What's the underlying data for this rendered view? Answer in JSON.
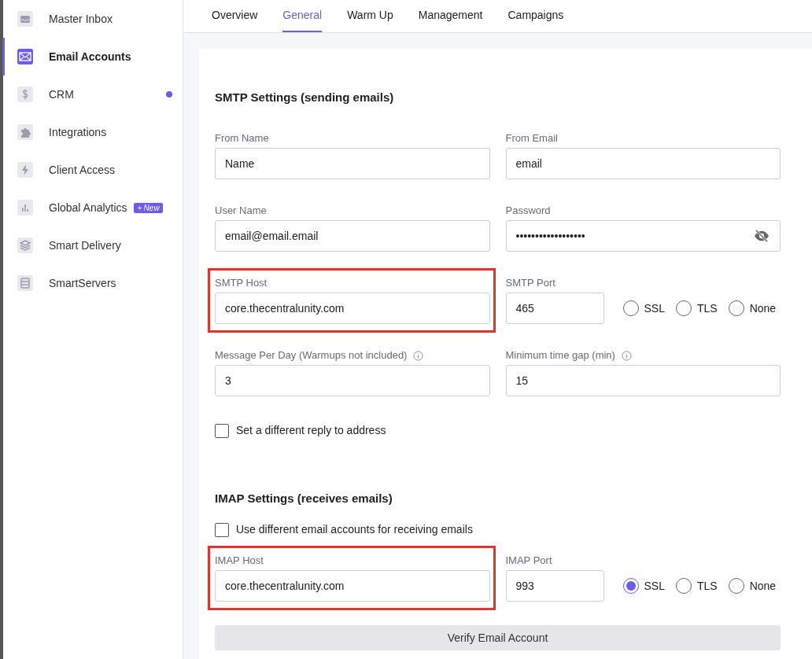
{
  "sidebar": {
    "items": [
      {
        "label": "Master Inbox",
        "selected": false
      },
      {
        "label": "Email Accounts",
        "selected": true
      },
      {
        "label": "CRM",
        "selected": false,
        "color": "#6a5cf0"
      },
      {
        "label": "Integrations",
        "selected": false
      },
      {
        "label": "Client Access",
        "selected": false
      },
      {
        "label": "Global Analytics",
        "selected": false,
        "badge": "New"
      },
      {
        "label": "Smart Delivery",
        "selected": false
      },
      {
        "label": "SmartServers",
        "selected": false
      }
    ]
  },
  "tabs": [
    {
      "label": "Overview",
      "selected": false
    },
    {
      "label": "General",
      "selected": true
    },
    {
      "label": "Warm Up",
      "selected": false
    },
    {
      "label": "Management",
      "selected": false
    },
    {
      "label": "Campaigns",
      "selected": false
    }
  ],
  "smtp": {
    "title": "SMTP Settings (sending emails)",
    "rows": [
      [
        {
          "kind": "text",
          "label": "From Name",
          "value": "Name",
          "highlighted": false
        },
        {
          "kind": "text",
          "label": "From Email",
          "value": "email",
          "highlighted": false
        }
      ],
      [
        {
          "kind": "text",
          "label": "User Name",
          "value": "email@email.email",
          "highlighted": false
        },
        {
          "kind": "password",
          "label": "Password",
          "value": "••••••••••••••••••",
          "highlighted": false
        }
      ],
      [
        {
          "kind": "text",
          "label": "SMTP Host",
          "value": "core.thecentralunity.com",
          "highlighted": true
        },
        {
          "kind": "port",
          "label": "SMTP Port",
          "value": "465",
          "highlighted": false,
          "options": [
            {
              "label": "SSL",
              "selected": false
            },
            {
              "label": "TLS",
              "selected": false
            },
            {
              "label": "None",
              "selected": false
            }
          ]
        }
      ],
      [
        {
          "kind": "text",
          "label": "Message Per Day (Warmups not included)",
          "value": "3",
          "info": true,
          "highlighted": false
        },
        {
          "kind": "text",
          "label": "Minimum time gap (min)",
          "value": "15",
          "info": true,
          "highlighted": false
        }
      ]
    ],
    "checkbox": {
      "label": "Set a different reply to address",
      "checked": false
    }
  },
  "imap": {
    "title": "IMAP Settings (receives emails)",
    "checkbox": {
      "label": "Use different email accounts for receiving emails",
      "checked": false
    },
    "rows": [
      [
        {
          "kind": "text",
          "label": "IMAP Host",
          "value": "core.thecentralunity.com",
          "highlighted": true
        },
        {
          "kind": "port",
          "label": "IMAP Port",
          "value": "993",
          "highlighted": false,
          "options": [
            {
              "label": "SSL",
              "selected": true
            },
            {
              "label": "TLS",
              "selected": false
            },
            {
              "label": "None",
              "selected": false
            }
          ]
        }
      ]
    ],
    "button": "Verify Email Account"
  }
}
